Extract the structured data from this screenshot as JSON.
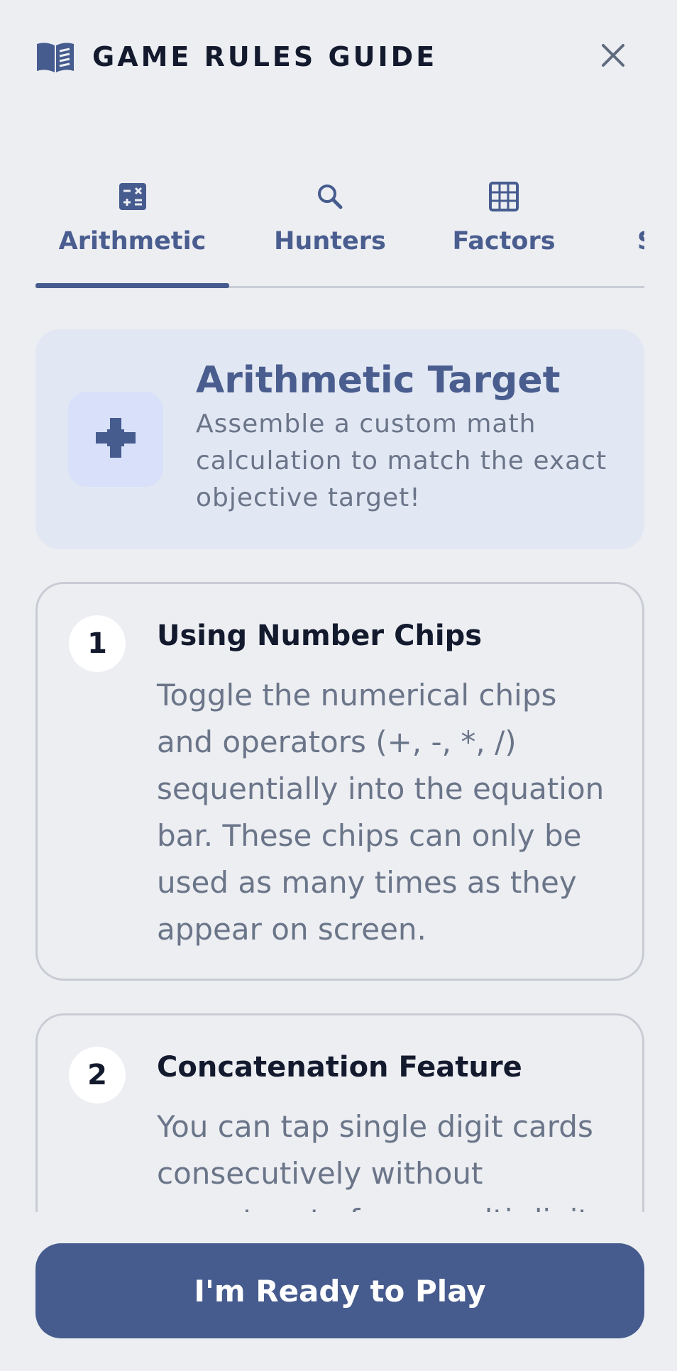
{
  "header": {
    "title": "GAME RULES GUIDE",
    "icon": "open-book-icon",
    "close_icon": "close-icon"
  },
  "tabs": [
    {
      "label": "Arithmetic",
      "icon": "calculator-icon",
      "active": true
    },
    {
      "label": "Hunters",
      "icon": "search-icon",
      "active": false
    },
    {
      "label": "Factors",
      "icon": "grid-icon",
      "active": false
    },
    {
      "label": "S",
      "icon": "",
      "active": false
    }
  ],
  "hero": {
    "title": "Arithmetic Target",
    "description": "Assemble a custom math calculation to match the exact objective target!",
    "icon": "plus-cross-icon"
  },
  "rules": [
    {
      "number": "1",
      "title": "Using Number Chips",
      "body": "Toggle the numerical chips and operators (+, -, *, /) sequentially into the equation bar. These chips can only be used as many times as they appear on screen."
    },
    {
      "number": "2",
      "title": "Concatenation Feature",
      "body": "You can tap single digit cards consecutively without operators to forge multi-digit"
    }
  ],
  "footer": {
    "button_label": "I'm Ready to Play"
  },
  "colors": {
    "background": "#eceef2",
    "accent": "#465b8e",
    "tab_text": "#4a5d8f",
    "hero_bg": "#e2e8f3",
    "hero_icon_bg": "#d8e0fa",
    "body_text": "#6b7589",
    "heading_text": "#141a2e"
  }
}
